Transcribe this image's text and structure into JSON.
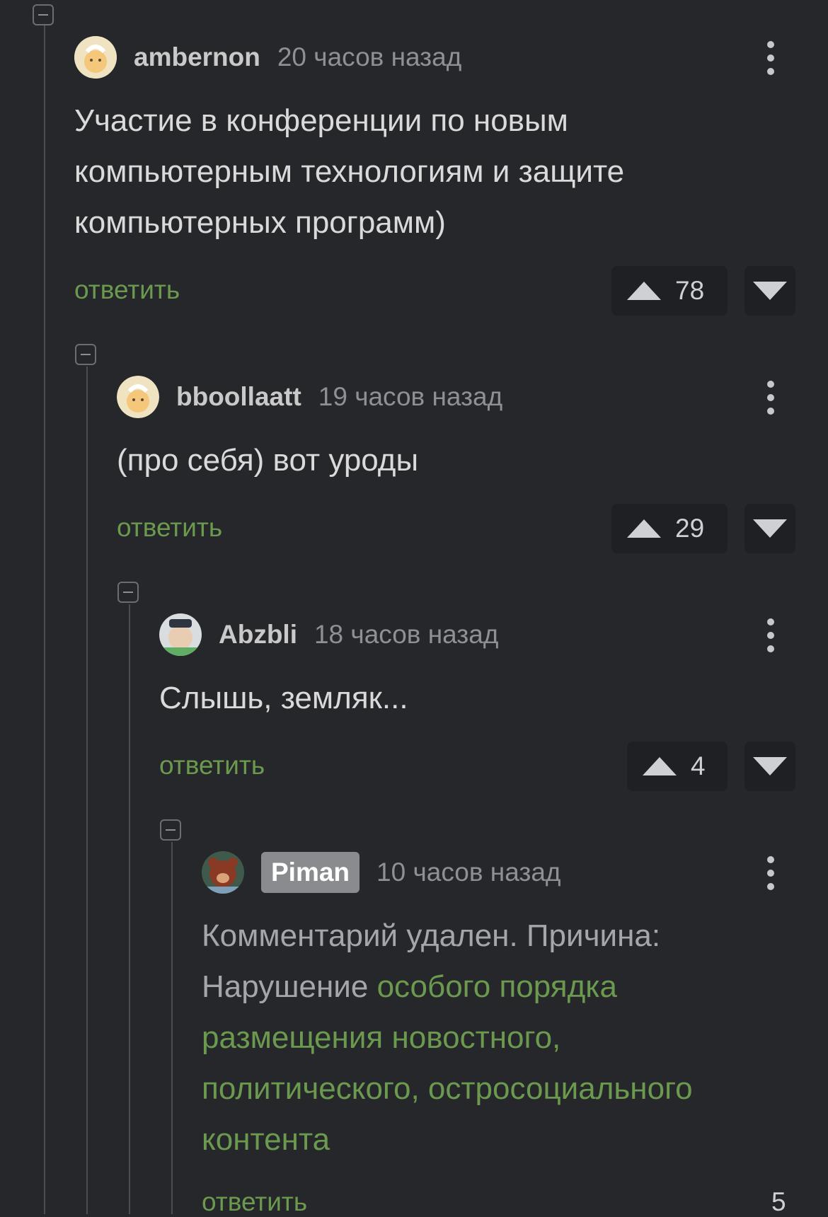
{
  "comments": [
    {
      "username": "ambernon",
      "time": "20 часов назад",
      "text": "Участие в конференции по новым компьютерным технологиям и защите компьютерных программ)",
      "reply": "ответить",
      "rating": "78"
    },
    {
      "username": "bboollaatt",
      "time": "19 часов назад",
      "text": "(про себя) вот уроды",
      "reply": "ответить",
      "rating": "29"
    },
    {
      "username": "Abzbli",
      "time": "18 часов назад",
      "text": "Слышь, земляк...",
      "reply": "ответить",
      "rating": "4"
    },
    {
      "username": "Piman",
      "time": "10 часов назад",
      "deleted_prefix": "Комментарий удален. Причина: Нарушение ",
      "deleted_link": "особого порядка размещения новостного, политического, остросоциального контента",
      "reply": "ответить",
      "rating": "5"
    }
  ],
  "icons": {
    "collapse": "collapse-icon",
    "menu": "more-vertical-icon",
    "upvote": "upvote-arrow-icon",
    "downvote": "downvote-arrow-icon"
  },
  "colors": {
    "background": "#26272b",
    "accent_green": "#6b9a4f",
    "vote_bg": "#1f2023"
  }
}
